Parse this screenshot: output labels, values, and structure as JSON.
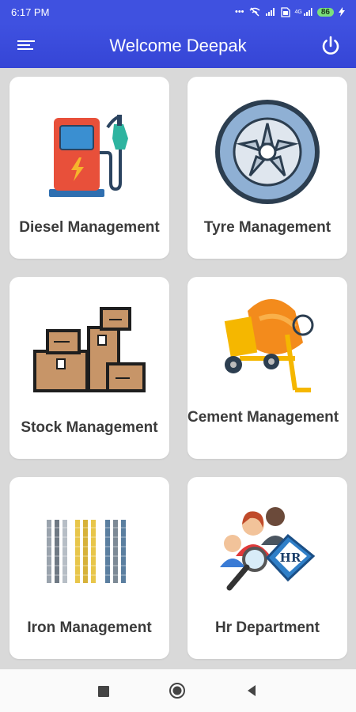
{
  "status_bar": {
    "time": "6:17 PM",
    "icons": [
      "dots-icon",
      "wifi-off-icon",
      "signal-icon",
      "sim-icon",
      "signal-4g-icon",
      "charging-icon"
    ],
    "network_label": "4G",
    "battery": "86"
  },
  "app_bar": {
    "title": "Welcome Deepak",
    "background": "#3f51e0",
    "menu_icon": "menu-icon",
    "power_icon": "power-icon"
  },
  "tiles": [
    {
      "label": "Diesel Management",
      "icon": "fuel-pump-icon"
    },
    {
      "label": "Tyre Management",
      "icon": "tyre-icon"
    },
    {
      "label": "Stock Management",
      "icon": "boxes-icon"
    },
    {
      "label": "Cement Management",
      "icon": "cement-mixer-icon"
    },
    {
      "label": "Iron Management",
      "icon": "iron-rods-icon"
    },
    {
      "label": "Hr Department",
      "icon": "hr-icon"
    }
  ],
  "nav_bar": {
    "icons": [
      "recents-icon",
      "home-icon",
      "back-icon"
    ]
  }
}
